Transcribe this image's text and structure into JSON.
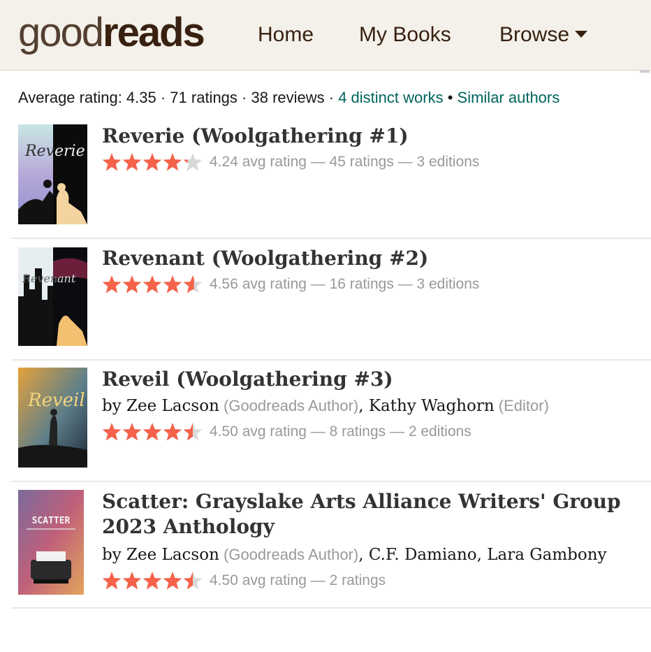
{
  "header": {
    "logo_part1": "good",
    "logo_part2": "reads",
    "nav": {
      "home": "Home",
      "my_books": "My Books",
      "browse": "Browse"
    }
  },
  "stats": {
    "average_rating": "Average rating: 4.35",
    "ratings": "71 ratings",
    "reviews": "38 reviews",
    "sep": " · ",
    "distinct_works": "4 distinct works",
    "bullet": " • ",
    "similar_authors": "Similar authors"
  },
  "colors": {
    "star": "#f4624a",
    "star_empty": "#d9d9d9",
    "link": "#00635d",
    "nav_bg": "#f4f1ea"
  },
  "works": [
    {
      "title": "Reverie (Woolgathering #1)",
      "stars": 4.24,
      "rating_text": "4.24 avg rating — 45 ratings — 3 editions",
      "cover_icon": "book-cover-reverie"
    },
    {
      "title": "Revenant (Woolgathering #2)",
      "stars": 4.56,
      "rating_text": "4.56 avg rating — 16 ratings — 3 editions",
      "cover_icon": "book-cover-revenant"
    },
    {
      "title": "Reveil (Woolgathering #3)",
      "by": "by ",
      "author1": "Zee Lacson",
      "author1_role": " (Goodreads Author)",
      "comma": ", ",
      "author2": "Kathy Waghorn",
      "author2_role": " (Editor)",
      "stars": 4.5,
      "rating_text": "4.50 avg rating — 8 ratings — 2 editions",
      "cover_icon": "book-cover-reveil"
    },
    {
      "title": "Scatter: Grayslake Arts Alliance Writers' Group 2023 Anthology",
      "by": "by ",
      "author1": "Zee Lacson",
      "author1_role": " (Goodreads Author)",
      "comma": ", ",
      "author2": "C.F. Damiano",
      "comma2": ", ",
      "author3": "Lara Gambony",
      "stars": 4.5,
      "rating_text": "4.50 avg rating — 2 ratings",
      "cover_text": "SCATTER",
      "cover_icon": "book-cover-scatter"
    }
  ]
}
